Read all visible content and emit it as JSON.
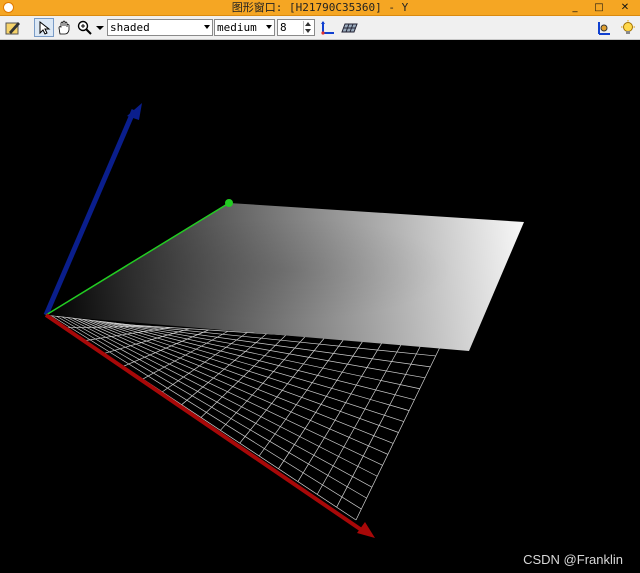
{
  "window": {
    "title": "图形窗口: [H21790C35360] - Y",
    "minimize_glyph": "_",
    "maximize_glyph": "□",
    "close_glyph": "✕"
  },
  "toolbar": {
    "icons": [
      "edit-icon",
      "select-arrow-icon",
      "pan-hand-icon",
      "zoom-icon",
      "dropdown-arrow-icon",
      "axis-icon",
      "grid-icon",
      "view-icon",
      "lightbulb-icon"
    ],
    "render_mode": "shaded",
    "quality": "medium",
    "level": "8"
  },
  "viewport": {
    "background": "#000000",
    "axis_colors": {
      "x": "#b01010",
      "y": "#22cc22",
      "z": "#1028a0"
    },
    "grid_color": "#cfcfcf",
    "surface_gradient": [
      "#000000",
      "#ffffff"
    ]
  },
  "watermark": "CSDN @Franklin"
}
